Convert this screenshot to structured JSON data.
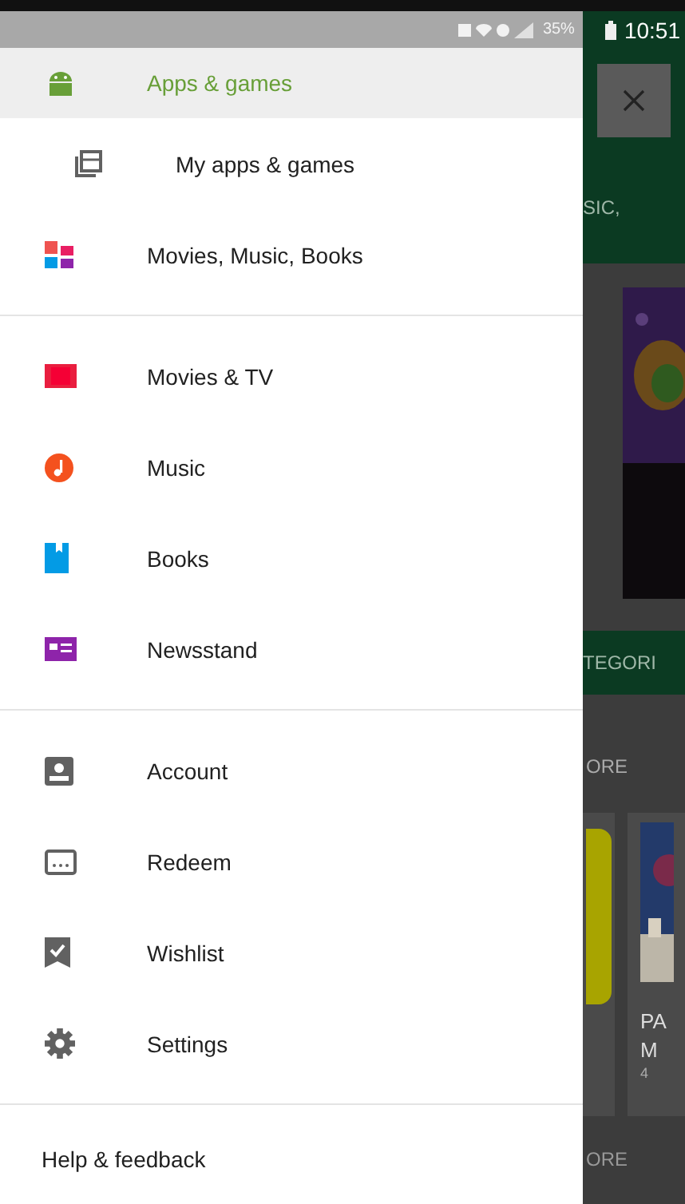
{
  "status_bar": {
    "battery": "35%",
    "time": "10:51"
  },
  "drawer": {
    "sections": [
      {
        "items": [
          {
            "kind": "primary",
            "label": "Apps & games",
            "selected": true
          },
          {
            "kind": "sub",
            "label": "My apps & games",
            "selected": false
          },
          {
            "kind": "primary",
            "label": "Movies, Music, Books",
            "selected": false
          }
        ]
      },
      {
        "items": [
          {
            "kind": "primary",
            "label": "Movies & TV",
            "selected": false
          },
          {
            "kind": "primary",
            "label": "Music",
            "selected": false
          },
          {
            "kind": "primary",
            "label": "Books",
            "selected": false
          },
          {
            "kind": "primary",
            "label": "Newsstand",
            "selected": false
          }
        ]
      },
      {
        "items": [
          {
            "kind": "primary",
            "label": "Account",
            "selected": false
          },
          {
            "kind": "primary",
            "label": "Redeem",
            "selected": false
          },
          {
            "kind": "primary",
            "label": "Wishlist",
            "selected": false
          },
          {
            "kind": "primary",
            "label": "Settings",
            "selected": false
          }
        ]
      },
      {
        "items": [
          {
            "kind": "text",
            "label": "Help & feedback",
            "selected": false
          }
        ]
      }
    ]
  },
  "background": {
    "header_text": "SIC,",
    "band_text": "TEGORI",
    "section_text": "ORE",
    "card_title_1": "PA",
    "card_title_2": "M",
    "card_rating": "4",
    "footer_text": "ORE"
  }
}
